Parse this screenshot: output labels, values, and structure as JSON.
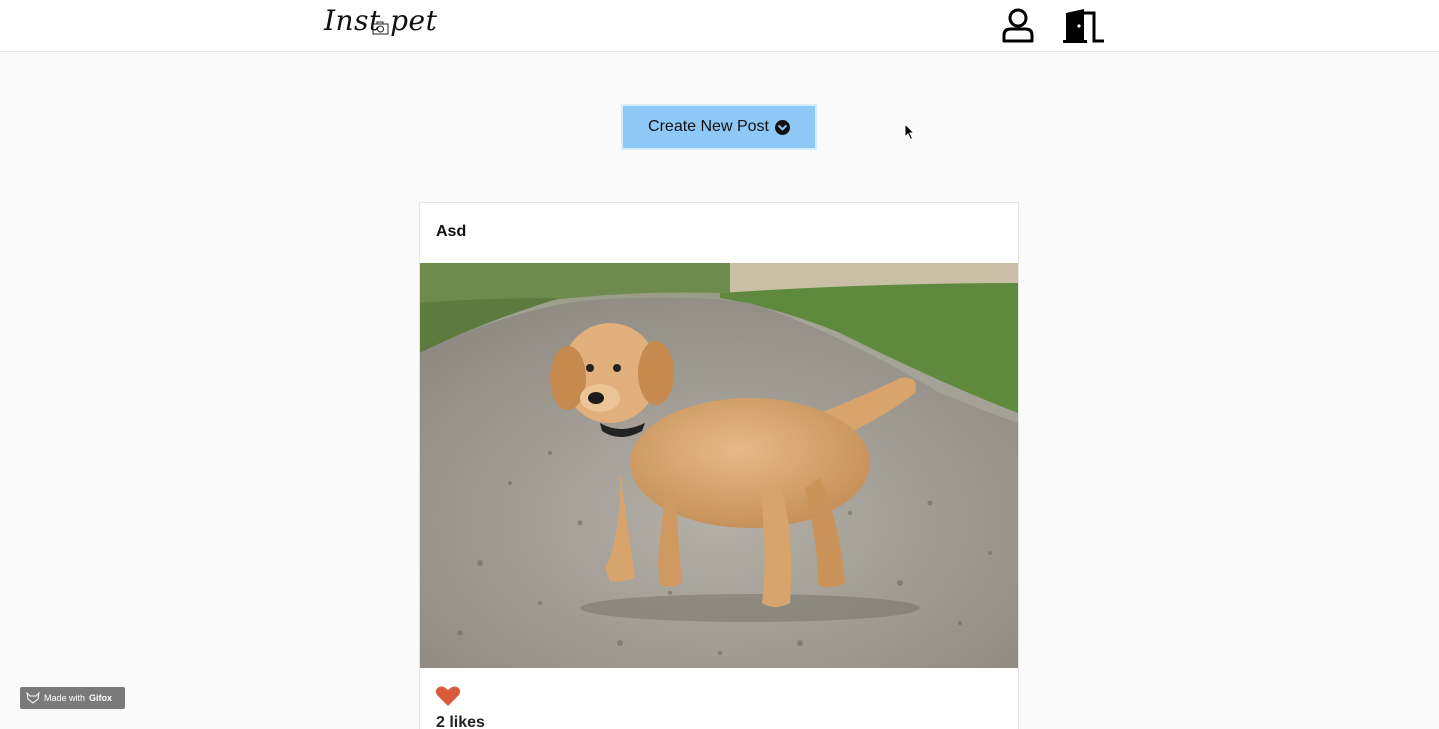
{
  "header": {
    "logo_text": "Inst  pet",
    "profile_icon": "user-icon",
    "logout_icon": "door-exit-icon"
  },
  "create_post": {
    "label": "Create New Post",
    "icon": "chevron-down-circle-icon"
  },
  "post": {
    "title": "Asd",
    "image_icon": "puppy-photo",
    "like_icon": "heart-icon",
    "likes_label": "2 likes"
  },
  "watermark": {
    "prefix": "Made with",
    "brand": "Gifox"
  },
  "colors": {
    "accent": "#8ec8f7",
    "heart": "#d9593b",
    "background": "#fafafa"
  }
}
